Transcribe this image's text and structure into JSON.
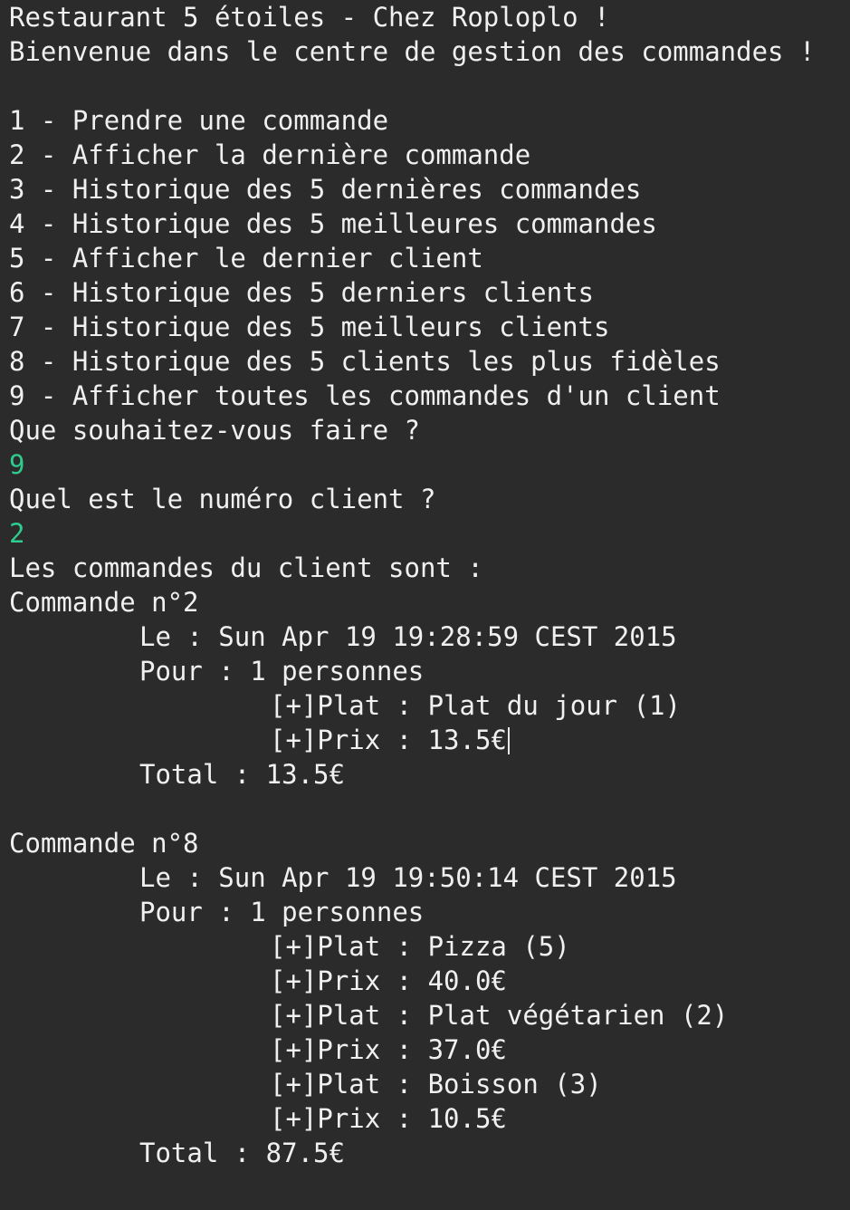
{
  "colors": {
    "background": "#2b2b2b",
    "text": "#f0f0f0",
    "user_input": "#2ecc8f"
  },
  "header": {
    "title": "Restaurant 5 étoiles - Chez Roploplo !",
    "welcome": "Bienvenue dans le centre de gestion des commandes !"
  },
  "menu": [
    "1 - Prendre une commande",
    "2 - Afficher la dernière commande",
    "3 - Historique des 5 dernières commandes",
    "4 - Historique des 5 meilleures commandes",
    "5 - Afficher le dernier client",
    "6 - Historique des 5 derniers clients",
    "7 - Historique des 5 meilleurs clients",
    "8 - Historique des 5 clients les plus fidèles",
    "9 - Afficher toutes les commandes d'un client"
  ],
  "prompt1": {
    "question": "Que souhaitez-vous faire ?",
    "answer": "9"
  },
  "prompt2": {
    "question": "Quel est le numéro client ?",
    "answer": "2"
  },
  "result_heading": "Les commandes du client sont :",
  "orders": [
    {
      "title": "Commande n°2",
      "date": "Le : Sun Apr 19 19:28:59 CEST 2015",
      "people": "Pour : 1 personnes",
      "items": [
        "[+]Plat : Plat du jour (1)",
        "[+]Prix : 13.5€"
      ],
      "total": "Total : 13.5€"
    },
    {
      "title": "Commande n°8",
      "date": "Le : Sun Apr 19 19:50:14 CEST 2015",
      "people": "Pour : 1 personnes",
      "items": [
        "[+]Plat : Pizza (5)",
        "[+]Prix : 40.0€",
        "[+]Plat : Plat végétarien (2)",
        "[+]Prix : 37.0€",
        "[+]Plat : Boisson (3)",
        "[+]Prix : 10.5€"
      ],
      "total": "Total : 87.5€"
    }
  ]
}
